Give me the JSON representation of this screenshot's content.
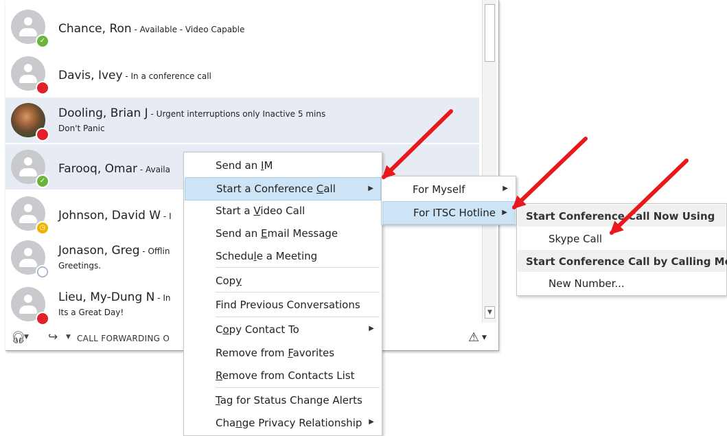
{
  "contacts": [
    {
      "name": "Chance, Ron",
      "status": " - Available - Video Capable",
      "note": "",
      "presence": "available",
      "avatar": "default"
    },
    {
      "name": "Davis, Ivey",
      "status": " - In a conference call",
      "note": "",
      "presence": "busy",
      "avatar": "default"
    },
    {
      "name": "Dooling, Brian J",
      "status": " - Urgent interruptions only Inactive 5 mins",
      "note": "Don't Panic",
      "presence": "busy",
      "avatar": "photo"
    },
    {
      "name": "Farooq, Omar",
      "status": " - Availa",
      "note": "",
      "presence": "available",
      "avatar": "default"
    },
    {
      "name": "Johnson, David W",
      "status": " - I",
      "note": "",
      "presence": "away",
      "avatar": "default"
    },
    {
      "name": "Jonason, Greg",
      "status": " - Offlin",
      "note": "Greetings.",
      "presence": "offline",
      "avatar": "default"
    },
    {
      "name": "Lieu, My-Dung N",
      "status": " - In",
      "note": "Its a Great Day!",
      "presence": "busy",
      "avatar": "default"
    }
  ],
  "bottombar": {
    "call_forwarding": "CALL FORWARDING O"
  },
  "context_menu": {
    "items": [
      {
        "pre": "Send an ",
        "acc": "I",
        "post": "M"
      },
      {
        "pre": "Start a Conference ",
        "acc": "C",
        "post": "all"
      },
      {
        "pre": "Start a ",
        "acc": "V",
        "post": "ideo Call"
      },
      {
        "pre": "Send an ",
        "acc": "E",
        "post": "mail Message"
      },
      {
        "pre": "Schedu",
        "acc": "l",
        "post": "e a Meeting"
      },
      {
        "pre": "Cop",
        "acc": "y",
        "post": ""
      },
      {
        "pre": "Find Previous Conversations",
        "acc": "",
        "post": ""
      },
      {
        "pre": "C",
        "acc": "o",
        "post": "py Contact To"
      },
      {
        "pre": "Remove from ",
        "acc": "F",
        "post": "avorites"
      },
      {
        "pre": "",
        "acc": "R",
        "post": "emove from Contacts List"
      },
      {
        "pre": "",
        "acc": "T",
        "post": "ag for Status Change Alerts"
      },
      {
        "pre": "Cha",
        "acc": "n",
        "post": "ge Privacy Relationship"
      }
    ]
  },
  "conference_submenu": {
    "items": [
      "For Myself",
      "For ITSC Hotline"
    ]
  },
  "hotline_submenu": {
    "header1": "Start Conference Call Now Using",
    "option1": "Skype Call",
    "header2": "Start Conference Call by Calling Me At",
    "option2": "New Number..."
  },
  "colors": {
    "highlight": "#cde4f7",
    "available": "#6cb33f",
    "busy": "#e0202a",
    "away": "#f0b400",
    "annotation_arrow": "#e8191c"
  },
  "icons": {
    "available": "check-icon",
    "away": "clock-icon",
    "headset": "headset-icon",
    "call_forward": "call-forward-icon",
    "warning": "warning-icon",
    "submenu": "chevron-right-icon"
  }
}
